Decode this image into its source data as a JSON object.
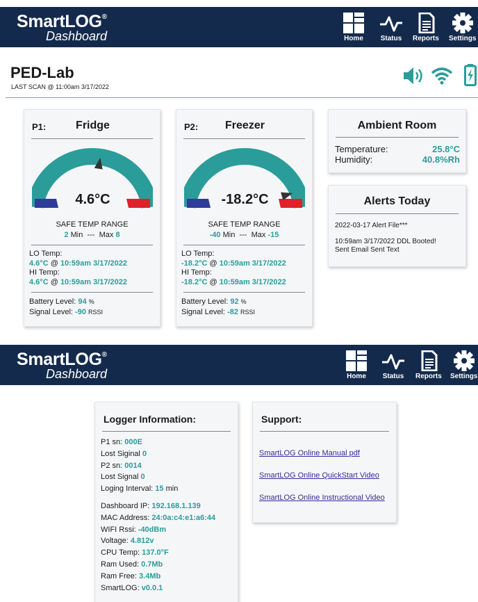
{
  "header": {
    "logo_line1": "SmartLOG",
    "logo_reg": "®",
    "logo_line2": "Dashboard",
    "nav": [
      {
        "label": "Home",
        "icon": "home-grid-icon"
      },
      {
        "label": "Status",
        "icon": "pulse-icon"
      },
      {
        "label": "Reports",
        "icon": "report-icon"
      },
      {
        "label": "Settings",
        "icon": "gear-icon"
      }
    ]
  },
  "page": {
    "title": "PED-Lab",
    "last_scan": "LAST SCAN @ 11:00am 3/17/2022",
    "status_icons": [
      "speaker-icon",
      "wifi-icon",
      "battery-icon"
    ]
  },
  "probes": [
    {
      "id": "P1:",
      "name": "Fridge",
      "temp": "4.6°C",
      "gauge_fraction": 0.55,
      "safe_label": "SAFE TEMP RANGE",
      "min": "2",
      "min_label": "Min",
      "sep": "---",
      "max_label": "Max",
      "max": "8",
      "lo_label": "LO Temp:",
      "lo_value": "4.6°C",
      "lo_at": "@",
      "lo_time": "10:59am 3/17/2022",
      "hi_label": "HI Temp:",
      "hi_value": "4.6°C",
      "hi_at": "@",
      "hi_time": "10:59am 3/17/2022",
      "battery_label": "Battery Level:",
      "battery": "94",
      "battery_unit": "%",
      "signal_label": "Signal Level:",
      "signal": "-90",
      "signal_unit": "RSSI"
    },
    {
      "id": "P2:",
      "name": "Freezer",
      "temp": "-18.2°C",
      "gauge_fraction": 0.91,
      "safe_label": "SAFE TEMP RANGE",
      "min": "-40",
      "min_label": "Min",
      "sep": "---",
      "max_label": "Max",
      "max": "-15",
      "lo_label": "LO Temp:",
      "lo_value": "-18.2°C",
      "lo_at": "@",
      "lo_time": "10:59am 3/17/2022",
      "hi_label": "HI Temp:",
      "hi_value": "-18.2°C",
      "hi_at": "@",
      "hi_time": "10:59am 3/17/2022",
      "battery_label": "Battery Level:",
      "battery": "92",
      "battery_unit": "%",
      "signal_label": "Signal Level:",
      "signal": "-82",
      "signal_unit": "RSSI"
    }
  ],
  "ambient": {
    "title": "Ambient Room",
    "temp_label": "Temperature:",
    "temp_value": "25.8°C",
    "hum_label": "Humidity:",
    "hum_value": "40.8%Rh"
  },
  "alerts": {
    "title": "Alerts Today",
    "line1": "2022-03-17 Alert File***",
    "line2": "10:59am 3/17/2022 DDL Booted!",
    "line3": "Sent Email Sent Text"
  },
  "logger": {
    "title": "Logger Information:",
    "rows": [
      {
        "label": "P1 sn:",
        "value": "000E",
        "unit": ""
      },
      {
        "label": "Lost Siginal",
        "value": "0",
        "unit": ""
      },
      {
        "label": "P2 sn:",
        "value": "0014",
        "unit": ""
      },
      {
        "label": "Lost Signal",
        "value": "0",
        "unit": ""
      },
      {
        "label": "Loging Interval:",
        "value": "15",
        "unit": "min"
      }
    ],
    "rows2": [
      {
        "label": "Dashboard IP:",
        "value": "192.168.1.139"
      },
      {
        "label": "MAC Address:",
        "value": "24:0a:c4:e1:a6:44"
      },
      {
        "label": "WIFI Rssi:",
        "value": "-40dBm"
      },
      {
        "label": "Voltage:",
        "value": "4.812v"
      },
      {
        "label": "CPU Temp:",
        "value": "137.0°F"
      },
      {
        "label": "Ram Used:",
        "value": "0.7Mb"
      },
      {
        "label": "Ram Free:",
        "value": "3.4Mb"
      },
      {
        "label": "SmartLOG:",
        "value": "v0.0.1"
      }
    ]
  },
  "support": {
    "title": "Support:",
    "links": [
      "SmartLOG Online Manual pdf",
      "SmartLOG Online QuickStart Video",
      "SmartLOG Online Instructional Video"
    ]
  },
  "colors": {
    "header_bg": "#142a4c",
    "accent_teal": "#2a9d9a",
    "gauge_blue": "#2e3d99",
    "gauge_red": "#e0202a",
    "link": "#3b2a9b"
  }
}
